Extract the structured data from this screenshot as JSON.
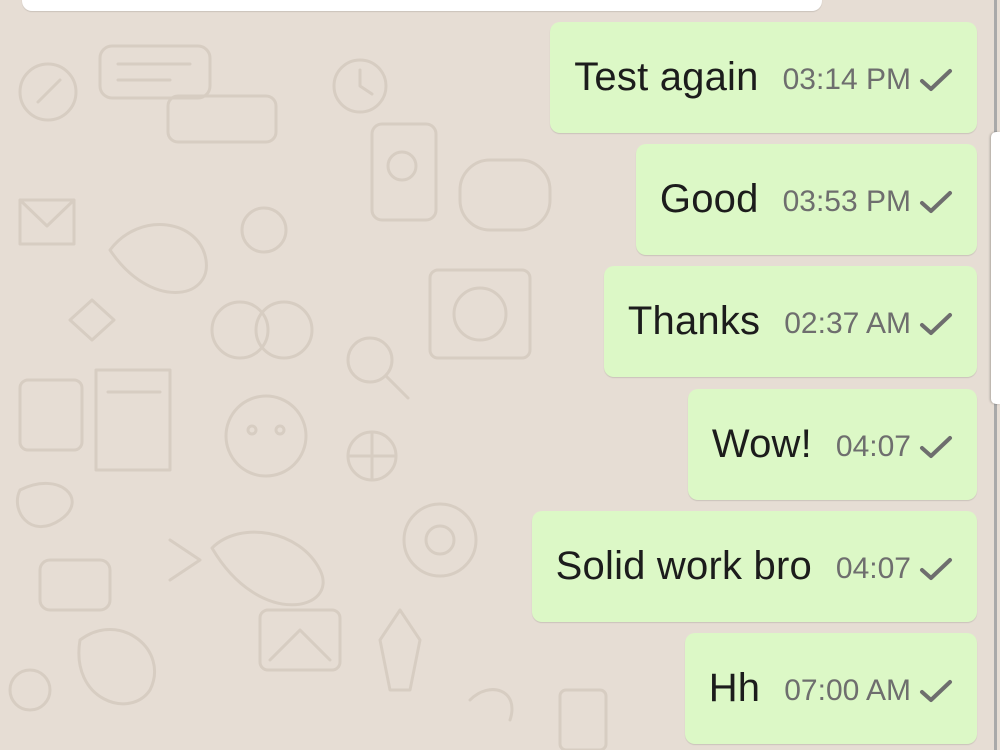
{
  "chat": {
    "messages": [
      {
        "text": "Test again",
        "time": "03:14 PM",
        "status": "check-icon"
      },
      {
        "text": "Good",
        "time": "03:53 PM",
        "status": "check-icon"
      },
      {
        "text": "Thanks",
        "time": "02:37 AM",
        "status": "check-icon"
      },
      {
        "text": "Wow!",
        "time": "04:07",
        "status": "check-icon"
      },
      {
        "text": "Solid work bro",
        "time": "04:07",
        "status": "check-icon"
      },
      {
        "text": "Hh",
        "time": "07:00 AM",
        "status": "check-icon"
      }
    ]
  },
  "colors": {
    "wallpaper": "#e6ddd4",
    "outgoing_bubble": "#dcf8c6",
    "message_text": "#1c1c1c",
    "meta_text": "#6e6e6e"
  }
}
